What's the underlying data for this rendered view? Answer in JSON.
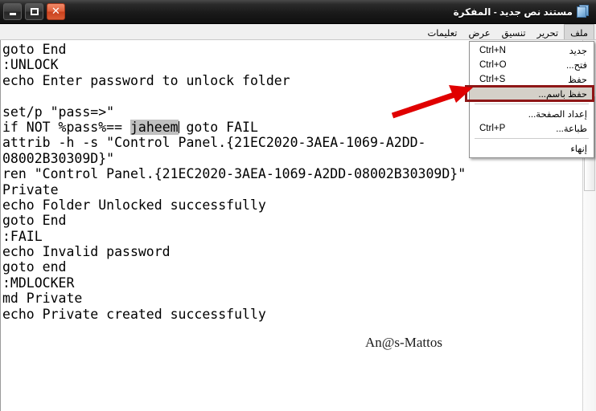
{
  "window": {
    "title": "مستند نص جديد - المفكرة",
    "icon": "notepad-document-icon",
    "controls": {
      "close": "✕",
      "maximize": "□",
      "minimize": "–"
    }
  },
  "menubar": {
    "items": [
      {
        "label": "ملف",
        "active": true
      },
      {
        "label": "تحرير",
        "active": false
      },
      {
        "label": "تنسيق",
        "active": false
      },
      {
        "label": "عرض",
        "active": false
      },
      {
        "label": "تعليمات",
        "active": false
      }
    ]
  },
  "file_menu": {
    "items": [
      {
        "label": "جديد",
        "accel": "Ctrl+N",
        "highlight": false,
        "separator_before": false
      },
      {
        "label": "فتح...",
        "accel": "Ctrl+O",
        "highlight": false,
        "separator_before": false
      },
      {
        "label": "حفظ",
        "accel": "Ctrl+S",
        "highlight": false,
        "separator_before": false
      },
      {
        "label": "حفظ باسم...",
        "accel": "",
        "highlight": true,
        "separator_before": false
      },
      {
        "label": "إعداد الصفحة...",
        "accel": "",
        "highlight": false,
        "separator_before": true
      },
      {
        "label": "طباعة...",
        "accel": "Ctrl+P",
        "highlight": false,
        "separator_before": false
      },
      {
        "label": "إنهاء",
        "accel": "",
        "highlight": false,
        "separator_before": true
      }
    ]
  },
  "annotation": {
    "highlight_color": "#8e1616",
    "arrow_color": "#e00000",
    "arrow_target": "حفظ باسم..."
  },
  "editor": {
    "lines": [
      "goto End",
      ":UNLOCK",
      "echo Enter password to unlock folder",
      "",
      "set/p \"pass=>\"",
      "if NOT %pass%== jaheem goto FAIL",
      "attrib -h -s \"Control Panel.{21EC2020-3AEA-1069-A2DD-",
      "08002B30309D}\"",
      "ren \"Control Panel.{21EC2020-3AEA-1069-A2DD-08002B30309D}\"",
      "Private",
      "echo Folder Unlocked successfully",
      "goto End",
      ":FAIL",
      "echo Invalid password",
      "goto end",
      ":MDLOCKER",
      "md Private",
      "echo Private created successfully"
    ],
    "selection": {
      "text": "jaheem",
      "line_index": 5,
      "prefix": "if NOT %pass%== ",
      "suffix": " goto FAIL",
      "background": "#c0c0c0"
    }
  },
  "watermark": {
    "text": "An@s-Mattos"
  },
  "scrollbar": {
    "orientation": "vertical",
    "name": "vertical-scrollbar"
  }
}
